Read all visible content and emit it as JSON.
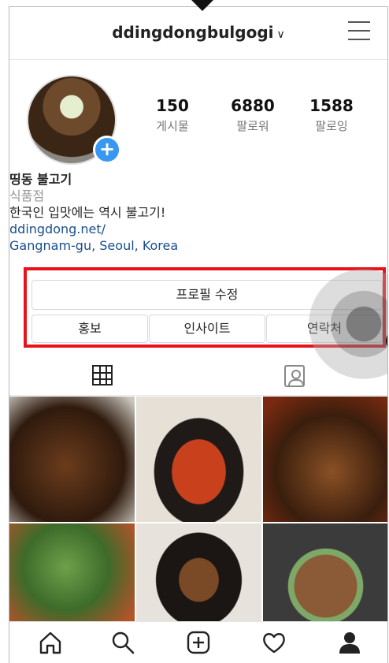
{
  "header": {
    "username": "ddingdongbulgogi",
    "chevron": "∨"
  },
  "stats": [
    {
      "count": "150",
      "label": "게시물"
    },
    {
      "count": "6880",
      "label": "팔로워"
    },
    {
      "count": "1588",
      "label": "팔로잉"
    }
  ],
  "profile": {
    "name": "띵동 불고기",
    "category": "식품점",
    "bio": "한국인 입맛에는 역시 불고기!",
    "website": "ddingdong.net/",
    "location": "Gangnam-gu, Seoul, Korea",
    "avatar_plus": "+"
  },
  "actions": {
    "edit_profile": "프로필 수정",
    "promote": "홍보",
    "insights": "인사이트",
    "contact": "연락처"
  },
  "icons": {
    "menu": "menu-icon",
    "grid_tab": "grid-icon",
    "tagged_tab": "tagged-icon",
    "nav": [
      "home-icon",
      "search-icon",
      "add-post-icon",
      "heart-icon",
      "profile-icon"
    ]
  },
  "colors": {
    "highlight": "#e8121b",
    "link": "#1a4e8e",
    "accent": "#3897f0"
  }
}
